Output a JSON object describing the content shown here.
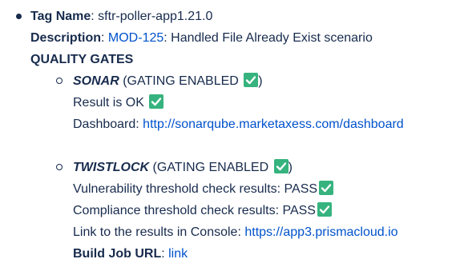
{
  "tag": {
    "label": "Tag Name",
    "value": ": sftr-poller-app1.21.0"
  },
  "description": {
    "label": "Description",
    "colon": ": ",
    "ticket": "MOD-125",
    "text": ": Handled File Already Exist scenario"
  },
  "quality_gates": {
    "heading": "QUALITY GATES",
    "sonar": {
      "name": "SONAR",
      "gating_open": " (GATING ENABLED ",
      "gating_close": ")",
      "result": "Result is OK ",
      "dashboard_label": "Dashboard: ",
      "dashboard_link": "http://sonarqube.marketaxess.com/dashboard"
    },
    "twistlock": {
      "name": "TWISTLOCK",
      "gating_open": " (GATING ENABLED ",
      "gating_close": ")",
      "vulnerability": "Vulnerability threshold check results: PASS",
      "compliance": "Compliance threshold check results: PASS",
      "console_label": "Link to the results in Console: ",
      "console_link": "https://app3.prismacloud.io"
    }
  },
  "build_job": {
    "label": "Build Job URL",
    "colon": ": ",
    "link": "link"
  },
  "colors": {
    "text": "#172b4d",
    "link": "#0052cc",
    "check": "#36b37e"
  },
  "icons": {
    "check": "check-box-icon",
    "bullet": "bullet-icon"
  }
}
